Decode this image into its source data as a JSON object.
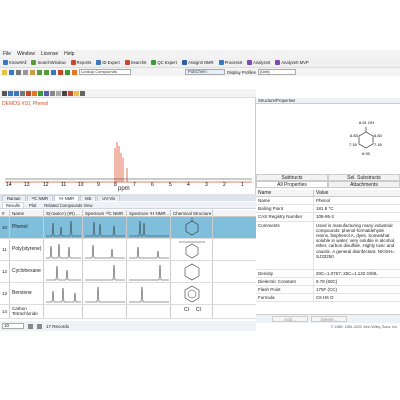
{
  "menu": [
    "File",
    "Window",
    "License",
    "Help"
  ],
  "toolbar1": {
    "items": [
      "KnowItAll",
      "SearchWindow",
      "Reports",
      "ID Expert",
      "SearchIt",
      "QC Expert",
      "AssignIt NMR",
      "ProcessIt",
      "AnalyzeIt",
      "AnalyzeIt MVP"
    ]
  },
  "toolbar2": {
    "search_placeholder": "Lookup Compounds",
    "pubchem_label": "PubChem",
    "display_profiles_label": "Display Profiles",
    "display_profile_value": "(Unit)"
  },
  "spectrum": {
    "title": "DEMOS #10, Phenol",
    "axis_ticks": [
      "14",
      "13",
      "12",
      "11",
      "10",
      "9",
      "8",
      "7",
      "6",
      "5",
      "4",
      "3",
      "2",
      "1"
    ],
    "xlabel": "ppm",
    "peak_color": "#e0502a"
  },
  "tabs": [
    "Raman",
    "¹³C NMR",
    "¹H NMR",
    "MS",
    "UV-Vis"
  ],
  "subtabs": [
    "Results",
    "Plot",
    "Related Compounds View"
  ],
  "table": {
    "headers": [
      "#",
      "Name",
      "S(<auto>) (IR) ...",
      "Spectrum ¹³C NMR ...",
      "Spectrum ¹H NMR ...",
      "Chemical Structure"
    ],
    "rows": [
      {
        "num": "10",
        "name": "Phenol"
      },
      {
        "num": "11",
        "name": "Poly(styrene)"
      },
      {
        "num": "12",
        "name": "Cyclohexane"
      },
      {
        "num": "13",
        "name": "Benzene"
      },
      {
        "num": "14",
        "name": "Carbon Tetrachloride"
      }
    ]
  },
  "footer": {
    "db_label": "NW DB: DEMOS",
    "page_value": "10",
    "record_count": "17 Records"
  },
  "right": {
    "structure_header": "Structure/Properties",
    "structure_labels": {
      "oh": "6.51 OH",
      "h1": "6.83",
      "h2": "7.18",
      "h3": "6.93",
      "h4": "7.18",
      "h5": "6.83"
    },
    "tabs_top": [
      "Subtructs",
      "Sel. Substructs"
    ],
    "tabs_bottom": [
      "All Properties",
      "Attachments"
    ],
    "props_header": [
      "Name",
      "Value"
    ],
    "props": [
      {
        "k": "Name",
        "v": "Phenol"
      },
      {
        "k": "Boiling Point",
        "v": "181.8 °C"
      },
      {
        "k": "CAS Registry Number",
        "v": "108-95-2"
      },
      {
        "k": "Comments",
        "v": "Used in manufacturing many industrial compounds: phenol-formaldehyde resins, bisphenol A, dyes. Somewhat soluble in water; very soluble in alcohol, ether, carbon disulfide. Highly toxic and caustic. A general disinfectant. NIOSH= SJ33250"
      },
      {
        "k": "Density",
        "v": "20C=1.0767; 25C=1.132 G/ML"
      },
      {
        "k": "Dielectric Constant",
        "v": "9.78 (60C)"
      },
      {
        "k": "Flash Point",
        "v": "175F (CC)"
      },
      {
        "k": "Formula",
        "v": "C6 H6 O"
      }
    ],
    "buttons": [
      "Add...",
      "Delete..."
    ],
    "copyright": "© 1980, 1981-2020 John Wiley, Sons, Inc."
  }
}
